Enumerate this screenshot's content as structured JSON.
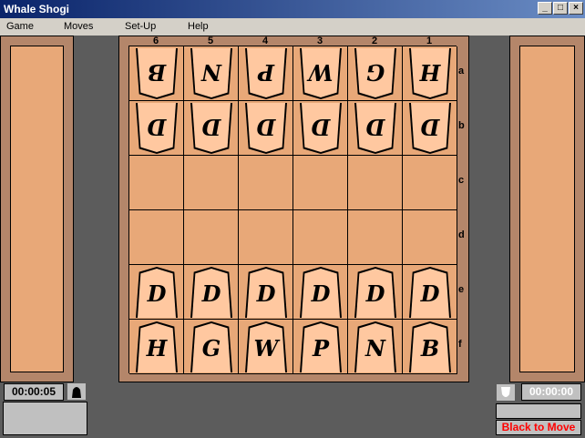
{
  "window": {
    "title": "Whale Shogi",
    "buttons": [
      "_",
      "□",
      "×"
    ]
  },
  "menu": [
    "Game",
    "Moves",
    "Set-Up",
    "Help"
  ],
  "files": [
    "6",
    "5",
    "4",
    "3",
    "2",
    "1"
  ],
  "ranks": [
    "a",
    "b",
    "c",
    "d",
    "e",
    "f"
  ],
  "board": [
    [
      {
        "p": "B",
        "o": "white"
      },
      {
        "p": "N",
        "o": "white"
      },
      {
        "p": "P",
        "o": "white"
      },
      {
        "p": "W",
        "o": "white"
      },
      {
        "p": "G",
        "o": "white"
      },
      {
        "p": "H",
        "o": "white"
      }
    ],
    [
      {
        "p": "D",
        "o": "white"
      },
      {
        "p": "D",
        "o": "white"
      },
      {
        "p": "D",
        "o": "white"
      },
      {
        "p": "D",
        "o": "white"
      },
      {
        "p": "D",
        "o": "white"
      },
      {
        "p": "D",
        "o": "white"
      }
    ],
    [
      null,
      null,
      null,
      null,
      null,
      null
    ],
    [
      null,
      null,
      null,
      null,
      null,
      null
    ],
    [
      {
        "p": "D",
        "o": "black"
      },
      {
        "p": "D",
        "o": "black"
      },
      {
        "p": "D",
        "o": "black"
      },
      {
        "p": "D",
        "o": "black"
      },
      {
        "p": "D",
        "o": "black"
      },
      {
        "p": "D",
        "o": "black"
      }
    ],
    [
      {
        "p": "H",
        "o": "black"
      },
      {
        "p": "G",
        "o": "black"
      },
      {
        "p": "W",
        "o": "black"
      },
      {
        "p": "P",
        "o": "black"
      },
      {
        "p": "N",
        "o": "black"
      },
      {
        "p": "B",
        "o": "black"
      }
    ]
  ],
  "black": {
    "clock": "00:00:05"
  },
  "white": {
    "clock": "00:00:00"
  },
  "status": "Black to Move",
  "colors": {
    "status": "#ff0000",
    "board": "#e8a878",
    "piece": "#ffc8a0"
  }
}
